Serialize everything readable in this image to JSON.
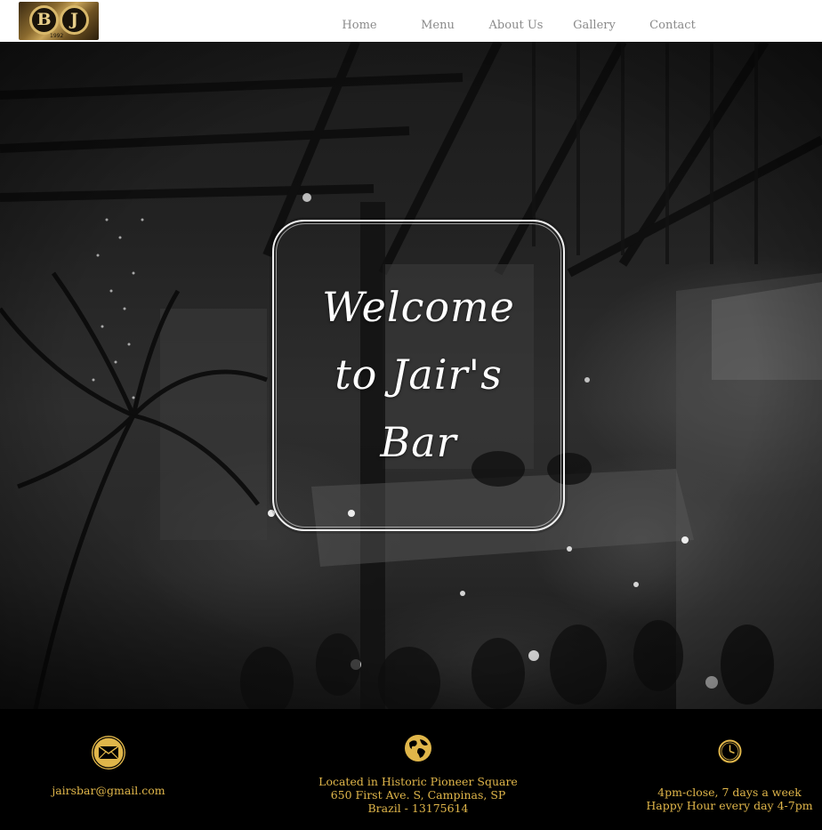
{
  "nav": {
    "logo_letters": [
      "B",
      "J"
    ],
    "logo_year": "1992",
    "links": [
      "Home",
      "Menu",
      "About Us",
      "Gallery",
      "Contact"
    ]
  },
  "hero": {
    "welcome_lines": [
      "Welcome",
      "to Jair's",
      "Bar"
    ]
  },
  "footer": {
    "email": {
      "icon": "envelope-icon",
      "text": "jairsbar@gmail.com"
    },
    "address": {
      "icon": "globe-icon",
      "lines": [
        "Located in Historic Pioneer Square",
        "650 First Ave. S, Campinas, SP",
        "Brazil - 13175614"
      ]
    },
    "hours": {
      "icon": "clock-icon",
      "lines": [
        "4pm-close, 7 days a week",
        "Happy Hour every day 4-7pm"
      ]
    }
  },
  "colors": {
    "accent_gold": "#e0b64a",
    "nav_background": "#ffffff",
    "nav_link": "#8a8a8a",
    "footer_background": "#000000"
  }
}
